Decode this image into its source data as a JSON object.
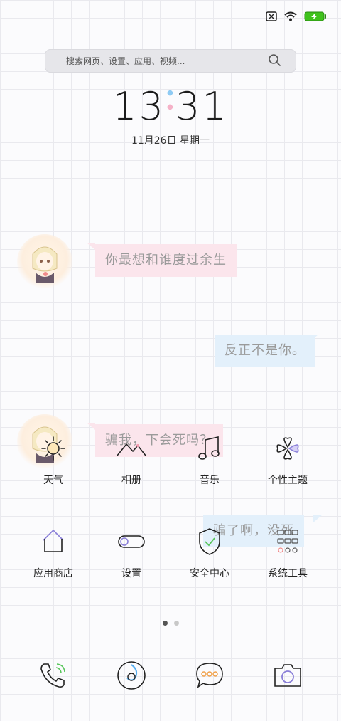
{
  "status_bar": {
    "icons": [
      "sim-none-icon",
      "wifi-icon",
      "battery-charging-icon"
    ],
    "battery_color": "#3fc21c"
  },
  "search": {
    "placeholder": "搜索网页、设置、应用、视频..."
  },
  "clock": {
    "hours": "13",
    "minutes": "31"
  },
  "date": "11月26日 星期一",
  "chat": [
    {
      "text": "你最想和谁度过余生",
      "style": "pink"
    },
    {
      "text": "反正不是你。",
      "style": "blue"
    },
    {
      "text": "骗我，下会死吗？",
      "style": "pink"
    },
    {
      "text": "骗了啊，没死",
      "style": "blue"
    }
  ],
  "apps": {
    "row1": [
      "天气",
      "相册",
      "音乐",
      "个性主题"
    ],
    "row2": [
      "应用商店",
      "设置",
      "安全中心",
      "系统工具"
    ]
  },
  "page_indicator": {
    "count": 2,
    "active": 1
  },
  "dock": [
    "phone-icon",
    "browser-icon",
    "messages-icon",
    "camera-icon"
  ]
}
